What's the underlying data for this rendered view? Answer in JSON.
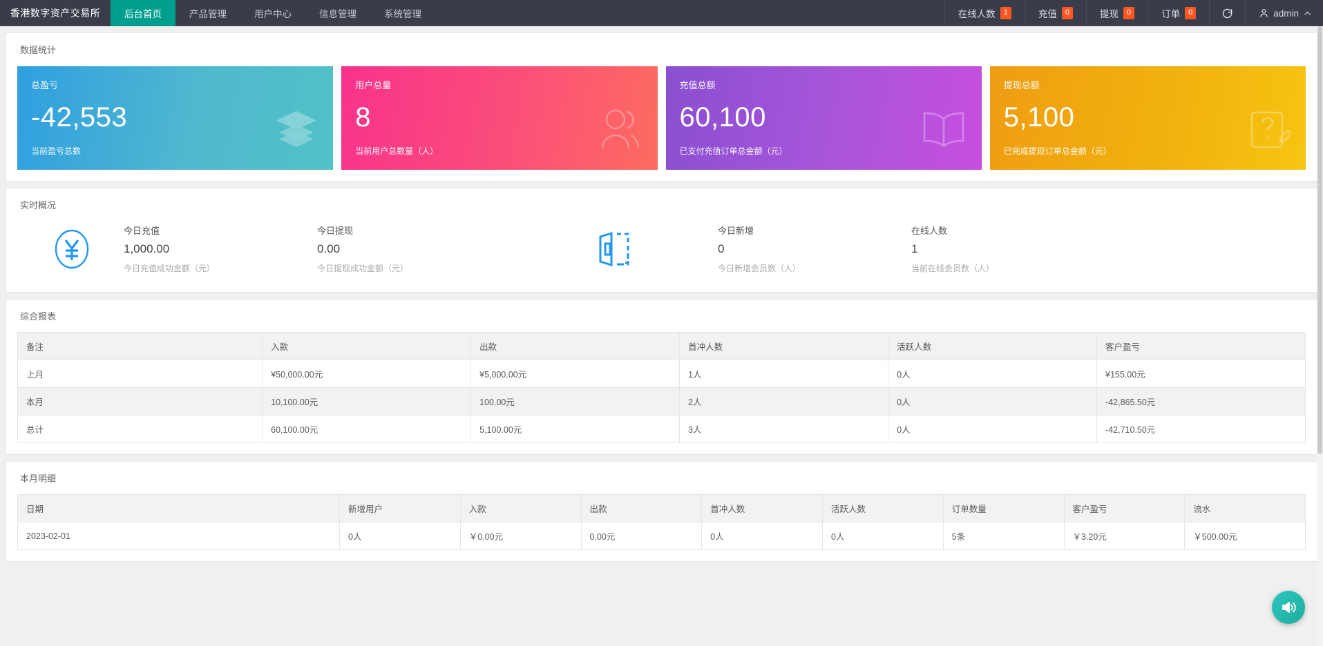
{
  "header": {
    "brand": "香港数字资产交易所",
    "nav": [
      {
        "label": "后台首页",
        "active": true
      },
      {
        "label": "产品管理",
        "active": false
      },
      {
        "label": "用户中心",
        "active": false
      },
      {
        "label": "信息管理",
        "active": false
      },
      {
        "label": "系统管理",
        "active": false
      }
    ],
    "stats": [
      {
        "label": "在线人数",
        "count": "1"
      },
      {
        "label": "充值",
        "count": "0"
      },
      {
        "label": "提现",
        "count": "0"
      },
      {
        "label": "订单",
        "count": "0"
      }
    ],
    "refresh_icon": "refresh-icon",
    "user": "admin",
    "badge_color": "#FF5722",
    "accent_color": "#009E8E"
  },
  "stats_panel": {
    "title": "数据统计",
    "cards": [
      {
        "label": "总盈亏",
        "value": "-42,553",
        "sub": "当前盈亏总数",
        "icon": "layers-icon",
        "color": "#2f9fe0"
      },
      {
        "label": "用户总量",
        "value": "8",
        "sub": "当前用户总数量（人）",
        "icon": "user-icon",
        "color": "#f8328c"
      },
      {
        "label": "充值总额",
        "value": "60,100",
        "sub": "已支付充值订单总金额（元）",
        "icon": "book-icon",
        "color": "#a955d9"
      },
      {
        "label": "提现总额",
        "value": "5,100",
        "sub": "已完成提现订单总金额（元）",
        "icon": "note-edit-icon",
        "color": "#f1b10d"
      }
    ]
  },
  "overview_panel": {
    "title": "实时概况",
    "left_icon": "yen-circle-icon",
    "right_icon": "door-exit-icon",
    "blocks_left": [
      {
        "title": "今日充值",
        "value": "1,000.00",
        "desc": "今日充值成功金额（元）"
      },
      {
        "title": "今日提现",
        "value": "0.00",
        "desc": "今日提现成功金额（元）"
      }
    ],
    "blocks_right": [
      {
        "title": "今日新增",
        "value": "0",
        "desc": "今日新增会员数（人）"
      },
      {
        "title": "在线人数",
        "value": "1",
        "desc": "当前在线会员数（人）"
      }
    ]
  },
  "report_panel": {
    "title": "综合报表",
    "columns": [
      "备注",
      "入款",
      "出款",
      "首冲人数",
      "活跃人数",
      "客户盈亏"
    ],
    "rows": [
      [
        "上月",
        "¥50,000.00元",
        "¥5,000.00元",
        "1人",
        "0人",
        "¥155.00元"
      ],
      [
        "本月",
        "10,100.00元",
        "100.00元",
        "2人",
        "0人",
        "-42,865.50元"
      ],
      [
        "总计",
        "60,100.00元",
        "5,100.00元",
        "3人",
        "0人",
        "-42,710.50元"
      ]
    ]
  },
  "detail_panel": {
    "title": "本月明细",
    "columns": [
      "日期",
      "新增用户",
      "入款",
      "出款",
      "首冲人数",
      "活跃人数",
      "订单数量",
      "客户盈亏",
      "流水"
    ],
    "rows": [
      [
        "2023-02-01",
        "0人",
        "￥0.00元",
        "0.00元",
        "0人",
        "0人",
        "5条",
        "￥3.20元",
        "￥500.00元"
      ]
    ]
  },
  "fab": {
    "icon": "sound-on-icon"
  }
}
